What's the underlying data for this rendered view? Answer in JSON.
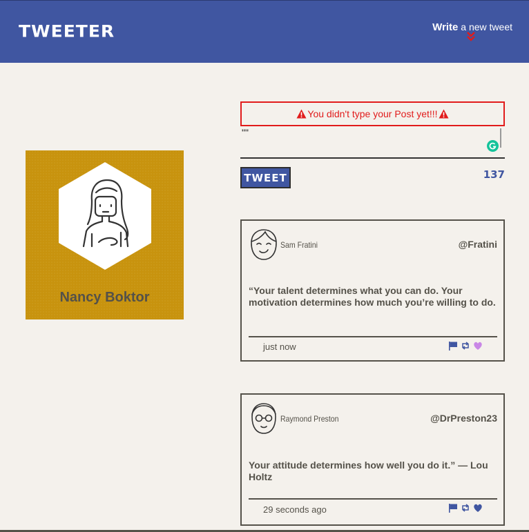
{
  "nav": {
    "brand": "TWEETER",
    "write_strong": "Write",
    "write_rest": "a new tweet",
    "write_icon": "double-chevron-down-icon",
    "accent": "#4056a1",
    "arrow_color": "#e11b1b"
  },
  "profile": {
    "name": "Nancy Boktor",
    "bg_color": "#c8930e"
  },
  "compose": {
    "error_message": "You didn't type your Post yet!!!",
    "textarea_value": "\"\"",
    "tweet_button": "TWEET",
    "counter": "137"
  },
  "tweets": [
    {
      "name": "Sam Fratini",
      "handle": "@Fratini",
      "text": "“Your talent determines what you can do. Your motivation determines how much you’re willing to do.",
      "time": "just now",
      "liked": true
    },
    {
      "name": "Raymond Preston",
      "handle": "@DrPreston23",
      "text": "Your attitude determines how well you do it.” — Lou Holtz",
      "time": "29 seconds ago",
      "liked": false
    }
  ]
}
